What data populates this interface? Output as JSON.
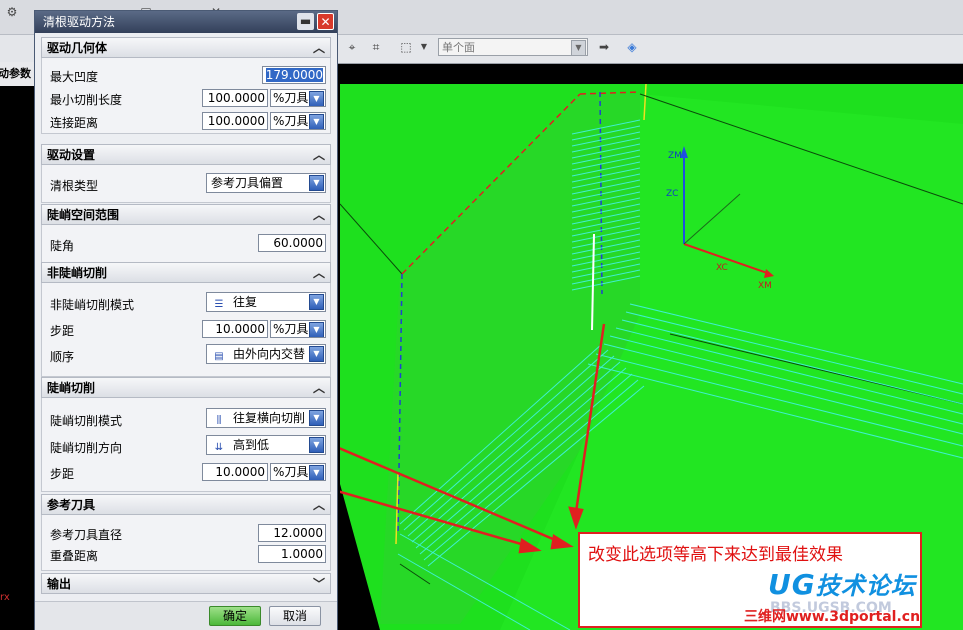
{
  "toolbar": {
    "select_filter": "单个面"
  },
  "left_panel": {
    "header": "动参数",
    "axis_mark": "rx"
  },
  "dialog": {
    "title": "清根驱动方法",
    "sections": {
      "geometry": {
        "title": "驱动几何体",
        "max_concavity_label": "最大凹度",
        "max_concavity_value": "179.0000",
        "min_cut_length_label": "最小切削长度",
        "min_cut_length_value": "100.0000",
        "min_cut_length_unit": "%刀具",
        "connect_distance_label": "连接距离",
        "connect_distance_value": "100.0000",
        "connect_distance_unit": "%刀具"
      },
      "drive": {
        "title": "驱动设置",
        "cleanup_type_label": "清根类型",
        "cleanup_type_value": "参考刀具偏置"
      },
      "steep_range": {
        "title": "陡峭空间范围",
        "steep_angle_label": "陡角",
        "steep_angle_value": "60.0000"
      },
      "non_steep": {
        "title": "非陡峭切削",
        "mode_label": "非陡峭切削模式",
        "mode_value": "往复",
        "stepover_label": "步距",
        "stepover_value": "10.0000",
        "stepover_unit": "%刀具",
        "order_label": "顺序",
        "order_value": "由外向内交替"
      },
      "steep": {
        "title": "陡峭切削",
        "mode_label": "陡峭切削模式",
        "mode_value": "往复横向切削",
        "direction_label": "陡峭切削方向",
        "direction_value": "高到低",
        "stepover_label": "步距",
        "stepover_value": "10.0000",
        "stepover_unit": "%刀具"
      },
      "ref_tool": {
        "title": "参考刀具",
        "diameter_label": "参考刀具直径",
        "diameter_value": "12.0000",
        "overlap_label": "重叠距离",
        "overlap_value": "1.0000"
      },
      "output": {
        "title": "输出"
      }
    },
    "ok_label": "确定",
    "cancel_label": "取消"
  },
  "viewport": {
    "axis_zm": "ZM",
    "axis_zc": "ZC",
    "axis_xc": "XC",
    "axis_xm": "XM"
  },
  "annotation": {
    "text": "改变此选项等高下来达到最佳效果"
  },
  "watermark": {
    "logo_latin": "UG",
    "logo_cn": "技术论坛",
    "site_cn": "三维网",
    "site_url": "www.3dportal.cn",
    "faint_url": "BBS.UGSB.COM"
  },
  "colors": {
    "part_green": "#1ee01e",
    "toolpath_cyan": "#3ef0d0",
    "annotation_red": "#e02020",
    "dropdown_blue": "#2f5fb8"
  }
}
